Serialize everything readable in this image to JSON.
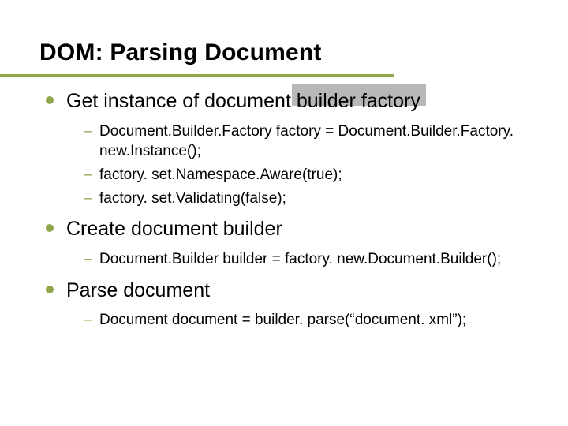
{
  "title": "DOM: Parsing Document",
  "items": [
    {
      "label": "Get instance of document builder factory",
      "sub": [
        "Document.Builder.Factory factory = Document.Builder.Factory. new.Instance();",
        "factory. set.Namespace.Aware(true);",
        "factory. set.Validating(false);"
      ]
    },
    {
      "label": "Create document builder",
      "sub": [
        "Document.Builder builder = factory. new.Document.Builder();"
      ]
    },
    {
      "label": "Parse document",
      "sub": [
        "Document document = builder. parse(“document. xml”);"
      ]
    }
  ]
}
